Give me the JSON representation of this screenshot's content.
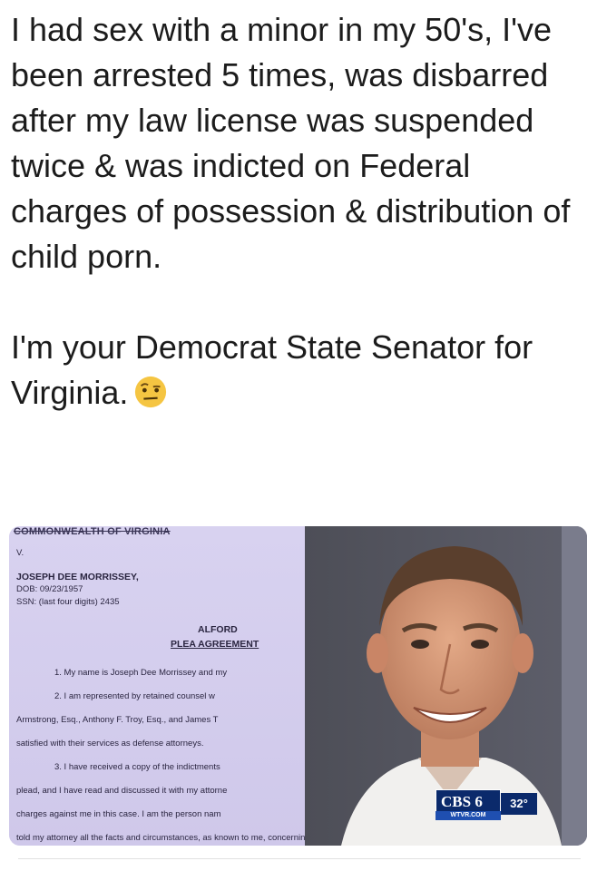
{
  "post": {
    "paragraph1": "I had sex with a minor in my 50's, I've been arrested 5 times, was disbarred after my law license was suspended twice & was indicted on Federal charges of possession & distribution of child porn.",
    "paragraph2": "I'm your Democrat State Senator for Virginia.",
    "emoji": "raised-eyebrow-face-icon"
  },
  "document": {
    "header": "COMMONWEALTH OF VIRGINIA",
    "v": "V.",
    "defendant": "JOSEPH DEE MORRISSEY,",
    "dob": "DOB: 09/23/1957",
    "ssn": "SSN: (last four digits) 2435",
    "title1": "ALFORD",
    "title2": "PLEA AGREEMENT",
    "lines": [
      "1.        My name is Joseph Dee Morrissey and my",
      "2.        I am represented by retained counsel w",
      "Armstrong, Esq., Anthony F. Troy, Esq., and James T",
      "satisfied with their services as defense attorneys.",
      "3.        I have received a copy of the indictments",
      "plead, and I have read and discussed it with my attorne",
      "charges against me in this case.  I am the person nam",
      "told my attorney all the facts and circumstances, as known to me, concerning the"
    ]
  },
  "news_bug": {
    "station": "CBS 6",
    "site": "WTVR.COM",
    "temperature": "32°"
  },
  "colors": {
    "document_bg": "#d8d2f0",
    "station_blue": "#0b2a6b"
  }
}
